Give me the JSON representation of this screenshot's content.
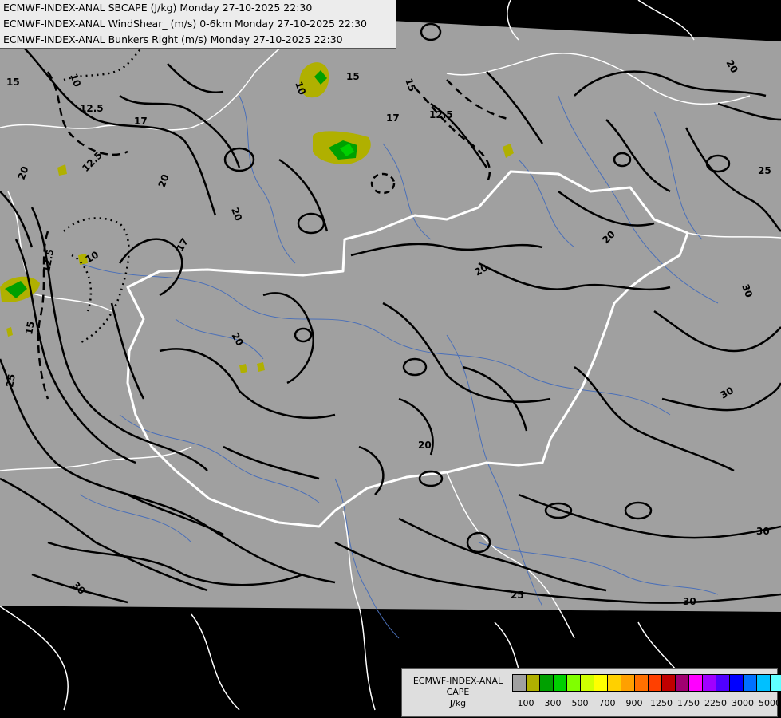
{
  "header": {
    "line1": "ECMWF-INDEX-ANAL SBCAPE (J/kg) Monday 27-10-2025 22:30",
    "line2": "ECMWF-INDEX-ANAL WindShear_ (m/s) 0-6km Monday 27-10-2025 22:30",
    "line3": "ECMWF-INDEX-ANAL Bunkers Right (m/s) Monday 27-10-2025 22:30"
  },
  "legend": {
    "title1": "ECMWF-INDEX-ANAL",
    "title2": "CAPE",
    "title3": "J/kg",
    "colors": [
      "#a0a0a0",
      "#b0b000",
      "#00a000",
      "#00d000",
      "#80ff00",
      "#d0ff00",
      "#ffff00",
      "#ffd000",
      "#ffa000",
      "#ff7000",
      "#ff4000",
      "#c00000",
      "#a00070",
      "#ff00ff",
      "#a000ff",
      "#5000ff",
      "#0000ff",
      "#0070ff",
      "#00c0ff",
      "#60ffff",
      "#ffffff"
    ],
    "tick_labels": [
      "100",
      "300",
      "500",
      "700",
      "900",
      "1250",
      "1750",
      "2250",
      "3000",
      "5000"
    ]
  },
  "contour_labels": {
    "l15a": "15",
    "l10a": "10",
    "l125a": "12.5",
    "l17a": "17",
    "l20a": "20",
    "l15b": "15",
    "l17b": "17",
    "l125b": "12.5",
    "l15c": "15",
    "l20b": "20",
    "l10b": "10",
    "l125c": "12.5",
    "l15d": "15",
    "l25a": "25",
    "l17c": "17",
    "l20c": "20",
    "l20d": "20",
    "l20e": "20",
    "l20f": "20",
    "l25b": "25",
    "l20g": "20",
    "l30a": "30",
    "l30b": "30",
    "l20h": "20",
    "l30c": "30",
    "l25c": "25",
    "l30d": "30",
    "l30e": "30",
    "l125d": "12.5",
    "l10c": "10"
  }
}
